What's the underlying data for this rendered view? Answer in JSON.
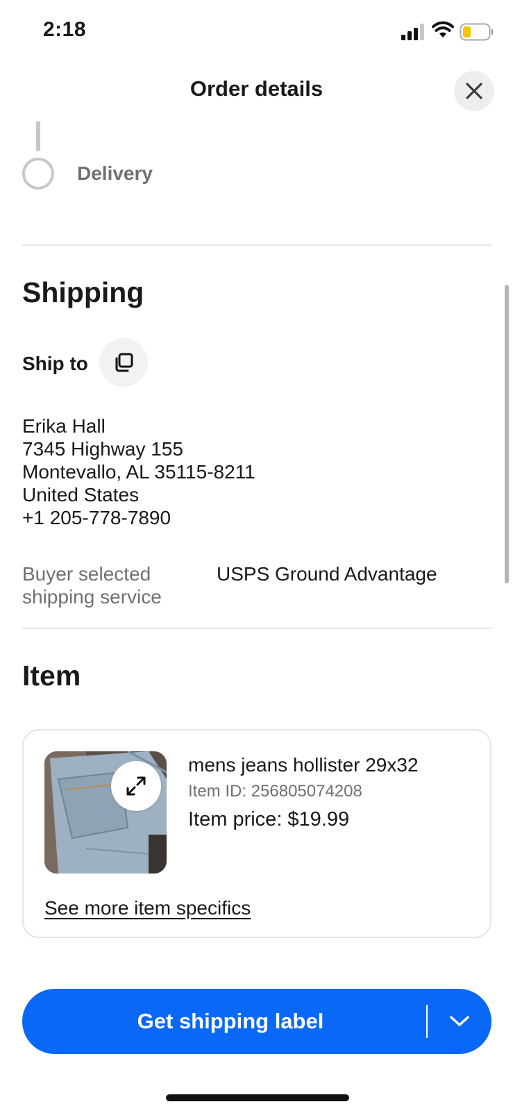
{
  "status_bar": {
    "time": "2:18",
    "icons": [
      "signal-icon",
      "wifi-icon",
      "battery-icon"
    ],
    "battery_color": "#f5c400"
  },
  "header": {
    "title": "Order details",
    "close_icon": "close-icon"
  },
  "timeline": {
    "step_label": "Delivery"
  },
  "shipping": {
    "title": "Shipping",
    "ship_to_label": "Ship to",
    "copy_icon": "copy-icon",
    "address": {
      "name": "Erika Hall",
      "street": "7345 Highway 155",
      "city_state_zip": "Montevallo, AL 35115-8211",
      "country": "United States",
      "phone": "+1 205-778-7890"
    },
    "service_label": "Buyer selected shipping service",
    "service_value": "USPS Ground Advantage"
  },
  "item": {
    "section_title": "Item",
    "title": "mens jeans hollister 29x32",
    "item_id": "Item ID: 256805074208",
    "price": "Item price: $19.99",
    "expand_icon": "expand-icon",
    "see_more_label": "See more item specifics"
  },
  "primary_action": {
    "label": "Get shipping label",
    "dropdown_icon": "chevron-down-icon",
    "color": "#0968f6"
  }
}
